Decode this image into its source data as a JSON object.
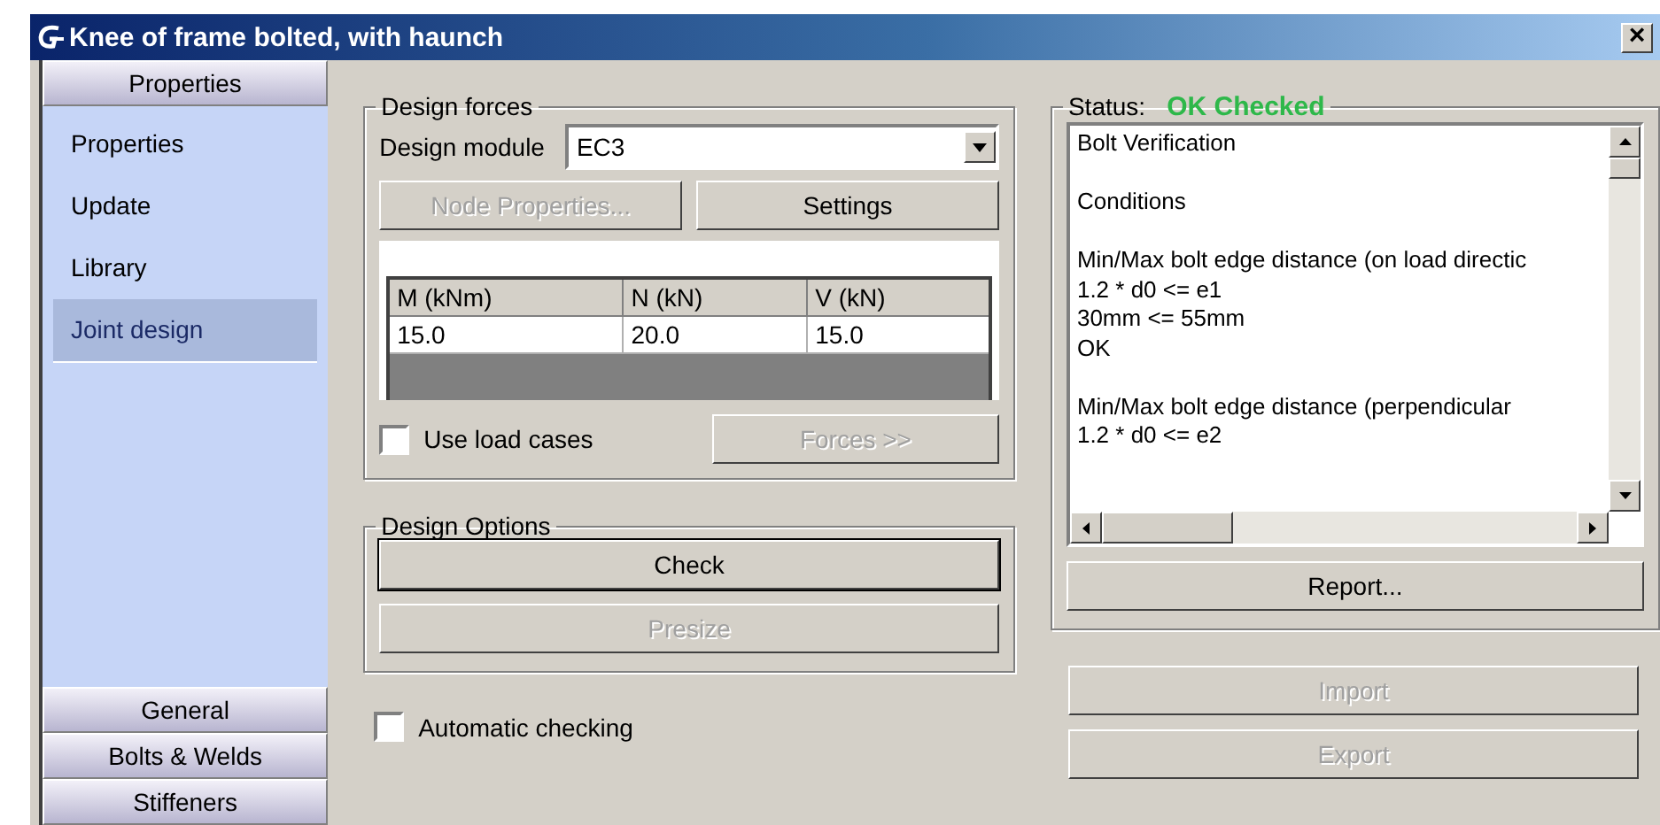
{
  "window": {
    "title": "Knee of frame bolted, with haunch",
    "close": "×"
  },
  "sidebar": {
    "header": "Properties",
    "items": [
      {
        "label": "Properties",
        "selected": false
      },
      {
        "label": "Update",
        "selected": false
      },
      {
        "label": "Library",
        "selected": false
      },
      {
        "label": "Joint design",
        "selected": true
      }
    ],
    "bottom_tabs": [
      "General",
      "Bolts & Welds",
      "Stiffeners"
    ]
  },
  "design_forces": {
    "title": "Design forces",
    "module_label": "Design module",
    "module_value": "EC3",
    "buttons": [
      {
        "label": "Node Properties...",
        "disabled": true
      },
      {
        "label": "Settings",
        "disabled": false
      }
    ],
    "table": {
      "columns": [
        "M (kNm)",
        "N (kN)",
        "V (kN)"
      ],
      "rows": [
        [
          "15.0",
          "20.0",
          "15.0"
        ]
      ]
    },
    "use_load_cases": {
      "label": "Use load cases",
      "checked": false
    },
    "forces_button": {
      "label": "Forces >>",
      "disabled": true
    }
  },
  "design_options": {
    "title": "Design Options",
    "buttons": [
      {
        "label": "Check",
        "disabled": false
      },
      {
        "label": "Presize",
        "disabled": true
      }
    ]
  },
  "automatic_checking": {
    "label": "Automatic checking",
    "checked": false
  },
  "status": {
    "label": "Status:",
    "value": "OK Checked",
    "paragraphs": [
      [
        "Bolt Verification"
      ],
      [
        "Conditions"
      ],
      [
        "Min/Max bolt edge distance (on load directic",
        "1.2 * d0 <=  e1",
        "30mm <= 55mm",
        "OK"
      ],
      [
        "Min/Max bolt edge distance (perpendicular",
        "1.2 * d0 <= e2"
      ]
    ]
  },
  "report_button": {
    "label": "Report...",
    "disabled": false
  },
  "side_buttons": [
    {
      "label": "Import",
      "disabled": true
    },
    {
      "label": "Export",
      "disabled": true
    }
  ]
}
